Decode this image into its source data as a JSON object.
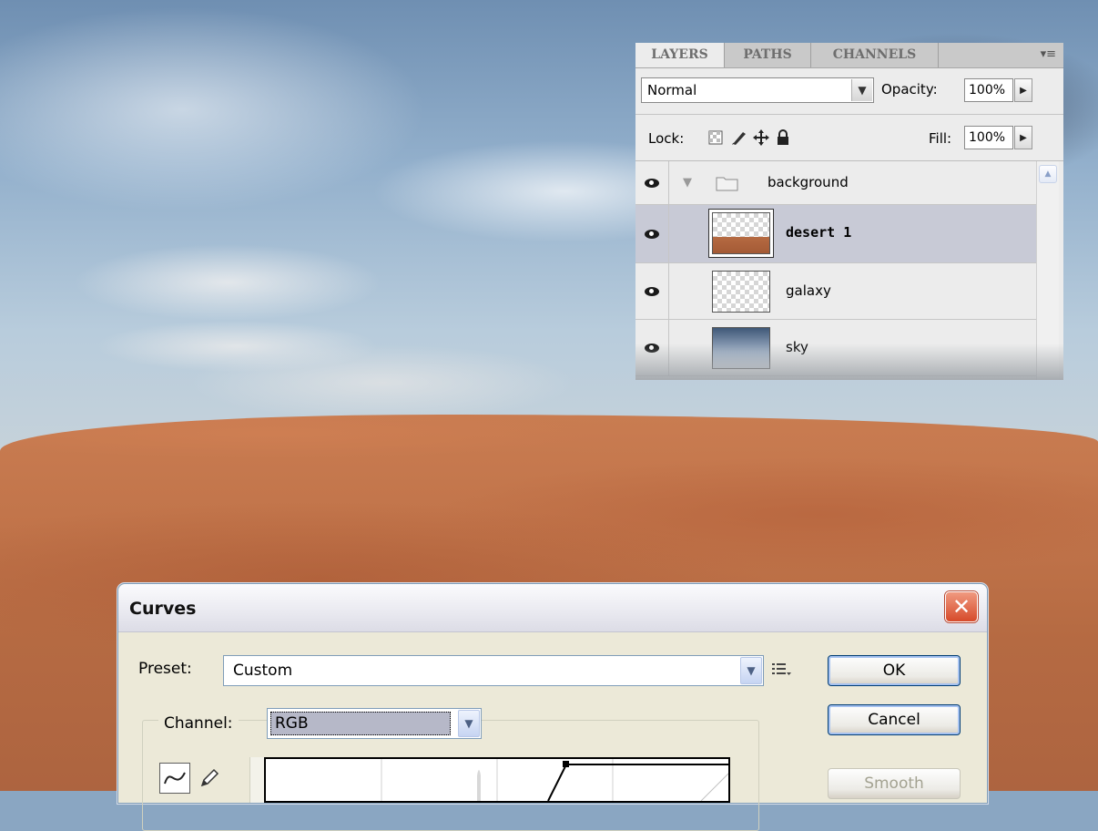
{
  "layers_panel": {
    "tabs": [
      {
        "label": "LAYERS"
      },
      {
        "label": "PATHS"
      },
      {
        "label": "CHANNELS"
      }
    ],
    "menu_icon": "▾≡",
    "blend_mode": "Normal",
    "opacity_label": "Opacity:",
    "opacity_value": "100%",
    "lock_label": "Lock:",
    "fill_label": "Fill:",
    "fill_value": "100%",
    "layers": [
      {
        "name": "background",
        "type": "group"
      },
      {
        "name": "desert 1",
        "selected": true
      },
      {
        "name": "galaxy"
      },
      {
        "name": "sky"
      }
    ]
  },
  "curves_dialog": {
    "title": "Curves",
    "close_symbol": "✕",
    "preset_label": "Preset:",
    "preset_value": "Custom",
    "channel_label": "Channel:",
    "channel_value": "RGB",
    "ok_label": "OK",
    "cancel_label": "Cancel",
    "smooth_label": "Smooth"
  }
}
